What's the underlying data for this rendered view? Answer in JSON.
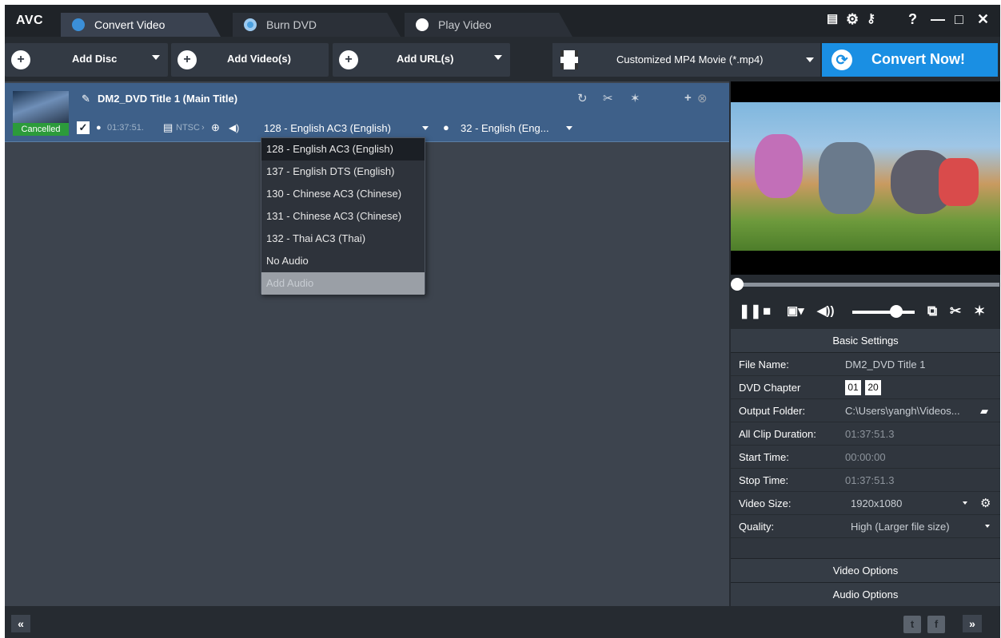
{
  "app": {
    "logo": "AVC"
  },
  "tabs": [
    {
      "label": "Convert Video",
      "active": true
    },
    {
      "label": "Burn DVD",
      "active": false
    },
    {
      "label": "Play Video",
      "active": false
    }
  ],
  "window_controls": {
    "help": "?",
    "minimize": "—",
    "maximize": "□",
    "close": "✕"
  },
  "toolbar": {
    "add_disc": "Add Disc",
    "add_videos": "Add Video(s)",
    "add_url": "Add URL(s)",
    "profile": "Customized MP4 Movie (*.mp4)",
    "convert_now": "Convert Now!"
  },
  "item": {
    "title": "DM2_DVD Title 1 (Main Title)",
    "status": "Cancelled",
    "duration": "01:37:51.",
    "standard": "NTSC",
    "audio_track": "128 - English AC3 (English)",
    "subtitle_track": "32 - English (Eng..."
  },
  "audio_dropdown": {
    "options": [
      "128 - English AC3 (English)",
      "137 - English DTS (English)",
      "130 - Chinese AC3 (Chinese)",
      "131 - Chinese AC3 (Chinese)",
      "132 - Thai AC3 (Thai)",
      "No Audio",
      "Add Audio"
    ],
    "selected": "128 - English AC3 (English)"
  },
  "player": {
    "progress_fraction": 0.0,
    "volume_fraction": 0.7
  },
  "settings": {
    "header": "Basic Settings",
    "file_name_label": "File Name:",
    "file_name": "DM2_DVD Title 1",
    "dvd_chapter_label": "DVD Chapter",
    "chapter_start": "01",
    "chapter_end": "20",
    "output_folder_label": "Output Folder:",
    "output_folder": "C:\\Users\\yangh\\Videos...",
    "all_clip_duration_label": "All Clip Duration:",
    "all_clip_duration": "01:37:51.3",
    "start_time_label": "Start Time:",
    "start_time": "00:00:00",
    "stop_time_label": "Stop Time:",
    "stop_time": "01:37:51.3",
    "video_size_label": "Video Size:",
    "video_size": "1920x1080",
    "quality_label": "Quality:",
    "quality": "High (Larger file size)",
    "video_options": "Video Options",
    "audio_options": "Audio Options"
  },
  "bottombar": {
    "collapse": "«",
    "expand": "»"
  },
  "colors": {
    "accent": "#1a8fe3",
    "item_bg": "#3e6089",
    "cancelled": "#2c9b3b"
  }
}
